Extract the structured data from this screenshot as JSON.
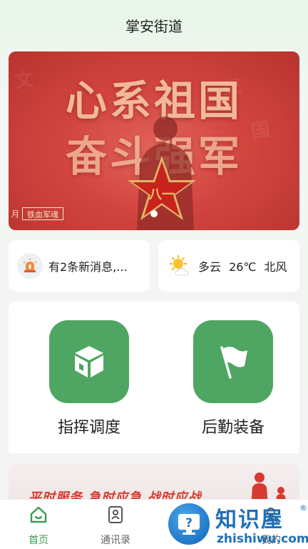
{
  "header": {
    "title": "掌安街道"
  },
  "banner": {
    "headline_line1": "心系祖国",
    "headline_line2": "奋斗强军",
    "tag_month": "月",
    "tag_text": "铁血军魂",
    "emblem_text": "八一",
    "colors": {
      "background": "#d2453f",
      "headline": "#f1b99a",
      "star": "#c9231d"
    }
  },
  "message": {
    "icon": "alarm-light-icon",
    "text": "有2条新消息,..."
  },
  "weather": {
    "icon": "partly-cloudy-icon",
    "condition": "多云",
    "temperature": "26℃",
    "wind": "北风"
  },
  "functions": [
    {
      "label": "指挥调度",
      "icon": "cube-box-icon"
    },
    {
      "label": "后勤装备",
      "icon": "flag-icon"
    }
  ],
  "promo": {
    "text": "平时服务  急时应急  战时应战"
  },
  "tabbar": {
    "items": [
      {
        "label": "首页",
        "icon": "home-icon",
        "active": true
      },
      {
        "label": "通讯录",
        "icon": "contact-card-icon",
        "active": false
      },
      {
        "label": "我的",
        "icon": "user-icon",
        "active": false
      }
    ],
    "active_color": "#3c9a52"
  },
  "watermark": {
    "title": "知识屋",
    "reg": "®",
    "url": "zhishiwu.com"
  }
}
